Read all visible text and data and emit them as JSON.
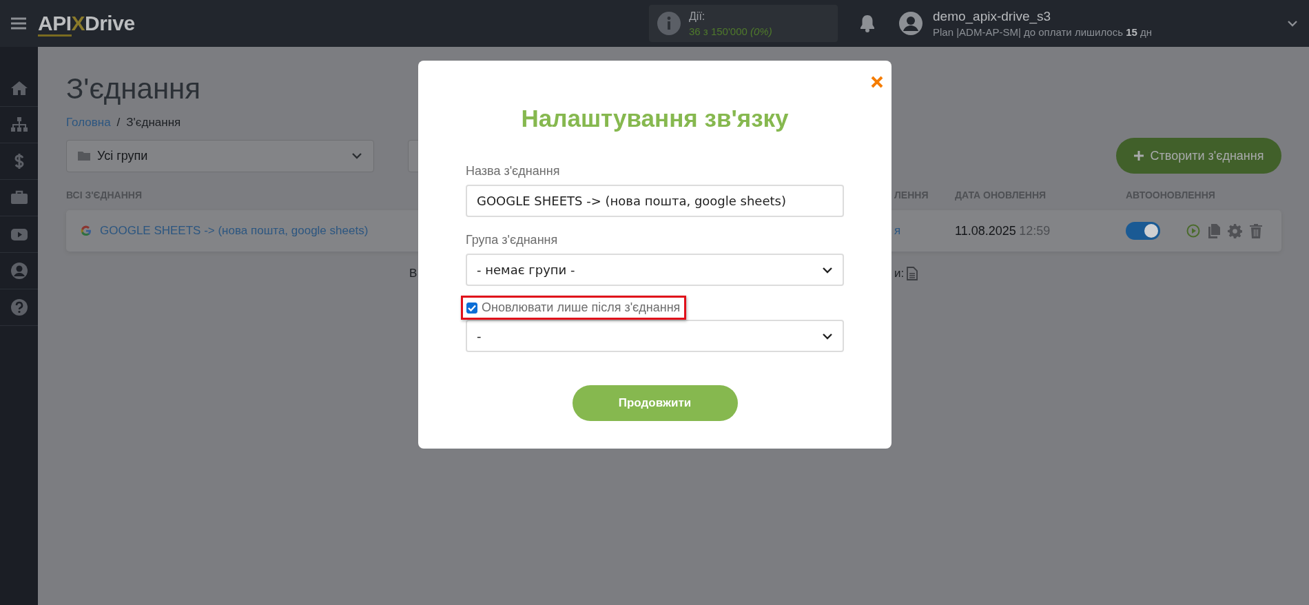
{
  "topbar": {
    "logo": {
      "prefix": "API",
      "mark": "X",
      "suffix": "Drive"
    },
    "actions": {
      "label": "Дії:",
      "value": "36 з 150'000 *(0%)*"
    },
    "user": {
      "name": "demo_apix-drive_s3",
      "plan": "Plan |ADM-AP-SM| до оплати лишилось **15** дн"
    }
  },
  "page": {
    "title": "З'єднання",
    "breadcrumb": [
      {
        "label": "Головна",
        "kind": "link"
      },
      {
        "label": "З'єднання",
        "kind": "current"
      }
    ],
    "breadcrumb_separator": "/",
    "group_filter": {
      "value": "Усі групи"
    },
    "create_button": "Створити з'єднання"
  },
  "table": {
    "columns": [
      "ВСІ З'ЄДНАННЯ",
      "ЛЕННЯ",
      "ДАТА ОНОВЛЕННЯ",
      "АВТООНОВЛЕННЯ"
    ],
    "rows": [
      {
        "name": "GOOGLE SHEETS -> (нова пошта, google sheets)",
        "column_2": "я",
        "date": "11.08.2025",
        "time": "12:59",
        "autoupdate": true
      }
    ]
  },
  "footer_fragments": {
    "left": "В",
    "right": "и:"
  },
  "modal": {
    "title": "Налаштування зв'язку",
    "fields": [
      {
        "kind": "input",
        "label": "Назва з'єднання",
        "value": "GOOGLE SHEETS -> (нова пошта, google sheets)"
      },
      {
        "kind": "select",
        "label": "Група з'єднання",
        "value": "- немає групи -"
      },
      {
        "kind": "checkbox",
        "label": "Оновлювати лише після з'єднання",
        "checked": true,
        "highlighted": true
      },
      {
        "kind": "select",
        "value": "-"
      }
    ],
    "submit": "Продовжити"
  }
}
